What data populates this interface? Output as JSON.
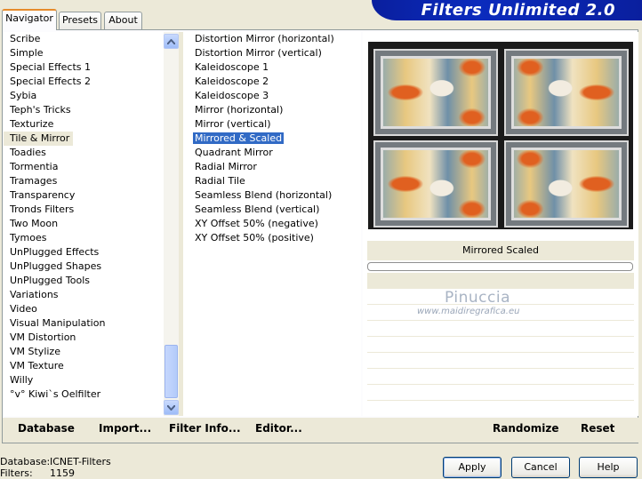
{
  "tabs": [
    "Navigator",
    "Presets",
    "About"
  ],
  "brand_title": "Filters Unlimited 2.0",
  "categories": [
    "Scribe",
    "Simple",
    "Special Effects 1",
    "Special Effects 2",
    "Sybia",
    "Teph's Tricks",
    "Texturize",
    "Tile & Mirror",
    "Toadies",
    "Tormentia",
    "Tramages",
    "Transparency",
    "Tronds Filters",
    "Two Moon",
    "Tymoes",
    "UnPlugged Effects",
    "UnPlugged Shapes",
    "UnPlugged Tools",
    "Variations",
    "Video",
    "Visual Manipulation",
    "VM Distortion",
    "VM Stylize",
    "VM Texture",
    "Willy",
    "°v° Kiwi`s Oelfilter"
  ],
  "selected_category": "Tile & Mirror",
  "filters": [
    "Distortion Mirror (horizontal)",
    "Distortion Mirror (vertical)",
    "Kaleidoscope 1",
    "Kaleidoscope 2",
    "Kaleidoscope 3",
    "Mirror (horizontal)",
    "Mirror (vertical)",
    "Mirrored & Scaled",
    "Quadrant Mirror",
    "Radial Mirror",
    "Radial Tile",
    "Seamless Blend (horizontal)",
    "Seamless Blend (vertical)",
    "XY Offset 50% (negative)",
    "XY Offset 50% (positive)"
  ],
  "selected_filter": "Mirrored & Scaled",
  "preview_filter_name": "Mirrored  Scaled",
  "watermark": {
    "name": "Pinuccia",
    "url": "www.maidiregrafica.eu"
  },
  "bottom_buttons": {
    "database": "Database",
    "import": "Import...",
    "filter_info": "Filter Info...",
    "editor": "Editor...",
    "randomize": "Randomize",
    "reset": "Reset"
  },
  "status": {
    "database_label": "Database:",
    "database_value": "ICNET-Filters",
    "filters_label": "Filters:",
    "filters_value": "1159"
  },
  "dialog_buttons": {
    "apply": "Apply",
    "cancel": "Cancel",
    "help": "Help"
  },
  "colors": {
    "selection": "#316ac5",
    "brand_bg": "#0b2bbd",
    "window_bg": "#ece9d8",
    "active_tab_accent": "#e68b2c"
  }
}
